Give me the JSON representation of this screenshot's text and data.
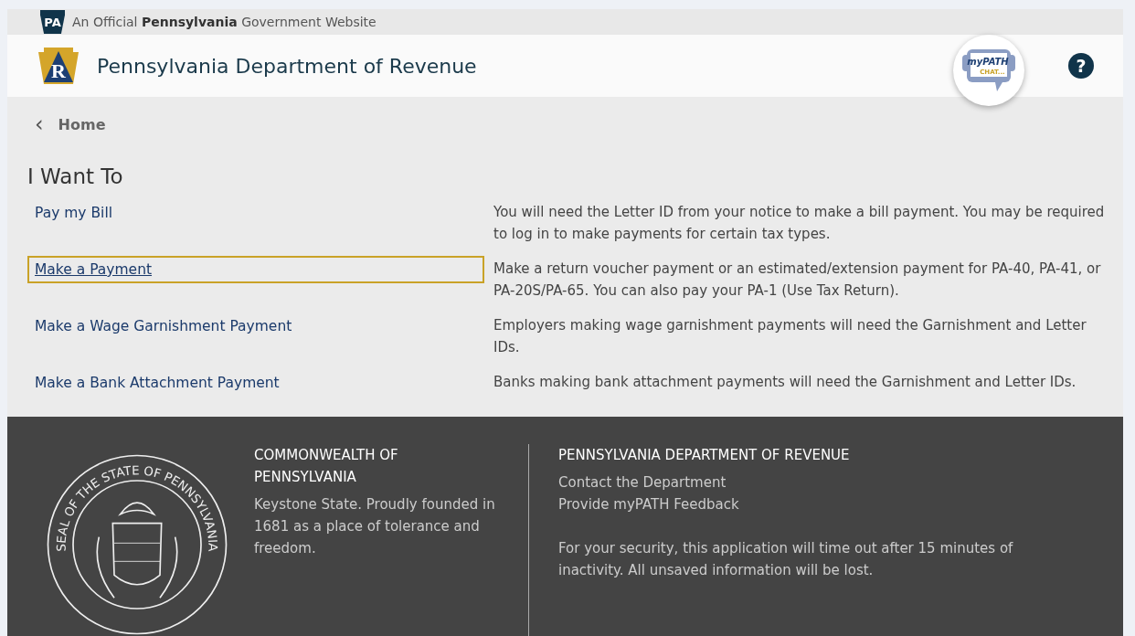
{
  "official_banner": {
    "badge": "PA",
    "text": "An Official **Pennsylvania** Government Website"
  },
  "header": {
    "logo_letter": "R",
    "title": "Pennsylvania Department of Revenue",
    "chat_logo": {
      "line_1": "myPATH",
      "line_2": "CHAT..."
    },
    "help_icon": "?"
  },
  "breadcrumb": {
    "icon": "‹",
    "label": "Home"
  },
  "heading": "I Want To",
  "options": [
    {
      "link": "Pay my Bill",
      "focused": false,
      "description": "You will need the Letter ID from your notice to make a bill payment. You may be required to log in to make payments for certain tax types."
    },
    {
      "link": "Make a Payment",
      "focused": true,
      "description": "Make a return voucher payment or an estimated/extension payment for PA-40, PA-41, or PA-20S/PA-65. You can also pay your PA-1 (Use Tax Return)."
    },
    {
      "link": "Make a Wage Garnishment Payment",
      "focused": false,
      "description": "Employers making wage garnishment payments will need the Garnishment and Letter IDs."
    },
    {
      "link": "Make a Bank Attachment Payment",
      "focused": false,
      "description": "Banks making bank attachment payments will need the Garnishment and Letter IDs."
    }
  ],
  "footer": {
    "seal_text": "SEAL OF THE STATE OF PENNSYLVANIA",
    "commonwealth": {
      "title": "COMMONWEALTH OF PENNSYLVANIA",
      "text": "Keystone State. Proudly founded in 1681 as a place of tolerance and freedom."
    },
    "department": {
      "title": "PENNSYLVANIA DEPARTMENT OF REVENUE",
      "links": [
        "Contact the Department",
        "Provide myPATH Feedback"
      ],
      "notice": "For your security, this application will time out after 15 minutes of inactivity. All unsaved information will be lost."
    }
  }
}
